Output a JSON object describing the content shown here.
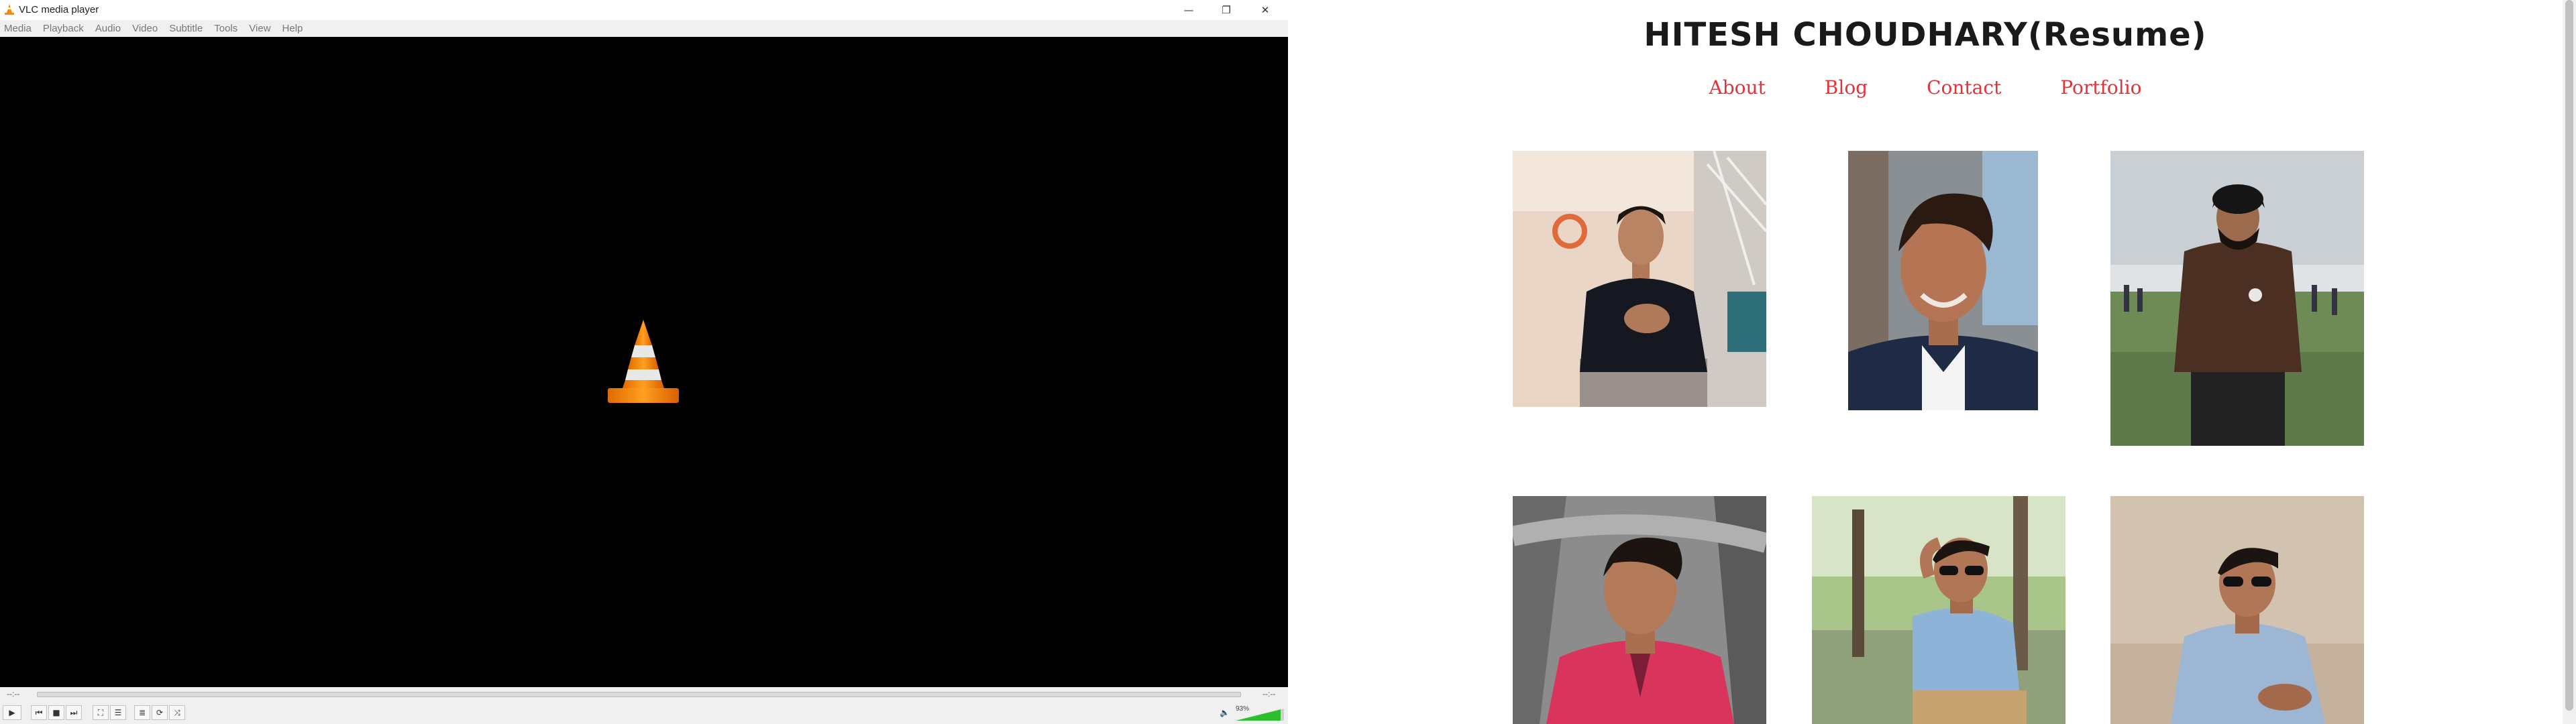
{
  "vlc": {
    "window_title": "VLC media player",
    "menu": [
      "Media",
      "Playback",
      "Audio",
      "Video",
      "Subtitle",
      "Tools",
      "View",
      "Help"
    ],
    "time_elapsed": "--:--",
    "time_remaining": "--:--",
    "volume_label": "93%",
    "volume_level": 0.93,
    "controls": {
      "play": "▶",
      "prev": "⏮",
      "stop": "■",
      "next": "⏭",
      "fullscreen": "⛶",
      "extended": "☰",
      "playlist": "≣",
      "loop": "⟳",
      "random": "⤨"
    },
    "window_buttons": {
      "minimize": "—",
      "maximize": "❐",
      "close": "✕"
    },
    "icons": {
      "app": "vlc-cone-icon",
      "video_center": "vlc-cone-icon",
      "volume": "speaker-icon"
    },
    "accent": "#ff8800"
  },
  "resume": {
    "title": "HITESH CHOUDHARY(Resume)",
    "nav": [
      "About",
      "Blog",
      "Contact",
      "Portfolio"
    ],
    "link_color": "#e2333b",
    "photos": [
      "portrait photo 1",
      "portrait photo 2",
      "portrait photo 3",
      "portrait photo 4",
      "portrait photo 5",
      "portrait photo 6"
    ]
  }
}
